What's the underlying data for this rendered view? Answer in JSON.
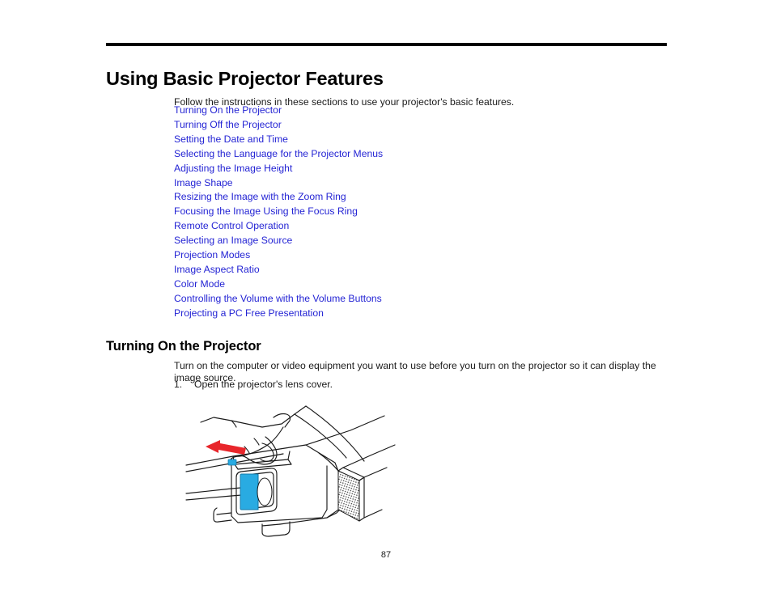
{
  "document": {
    "title": "Using Basic Projector Features",
    "intro": "Follow the instructions in these sections to use your projector's basic features.",
    "page_number": "87"
  },
  "link_list": [
    {
      "label": "Turning On the Projector"
    },
    {
      "label": "Turning Off the Projector"
    },
    {
      "label": "Setting the Date and Time"
    },
    {
      "label": "Selecting the Language for the Projector Menus"
    },
    {
      "label": "Adjusting the Image Height"
    },
    {
      "label": "Image Shape"
    },
    {
      "label": "Resizing the Image with the Zoom Ring"
    },
    {
      "label": "Focusing the Image Using the Focus Ring"
    },
    {
      "label": "Remote Control Operation"
    },
    {
      "label": "Selecting an Image Source"
    },
    {
      "label": "Projection Modes"
    },
    {
      "label": "Image Aspect Ratio"
    },
    {
      "label": "Color Mode"
    },
    {
      "label": "Controlling the Volume with the Volume Buttons"
    },
    {
      "label": "Projecting a PC Free Presentation"
    }
  ],
  "section": {
    "heading": "Turning On the Projector",
    "body": "Turn on the computer or video equipment you want to use before you turn on the projector so it can display the image source.",
    "step_number": "1.",
    "step_text": "Open the projector's lens cover."
  },
  "figure": {
    "caption": "",
    "alt": "Hand sliding open the lens cover on the front of a projector, red arrow pointing left",
    "colors": {
      "lens_cover": "#29ABE2",
      "arrow": "#E8262B",
      "outline": "#1a1a1a"
    }
  },
  "theme": {
    "link_color": "#2424d4",
    "text_color": "#1a1a1a",
    "rule_color": "#000000",
    "background": "#ffffff"
  }
}
